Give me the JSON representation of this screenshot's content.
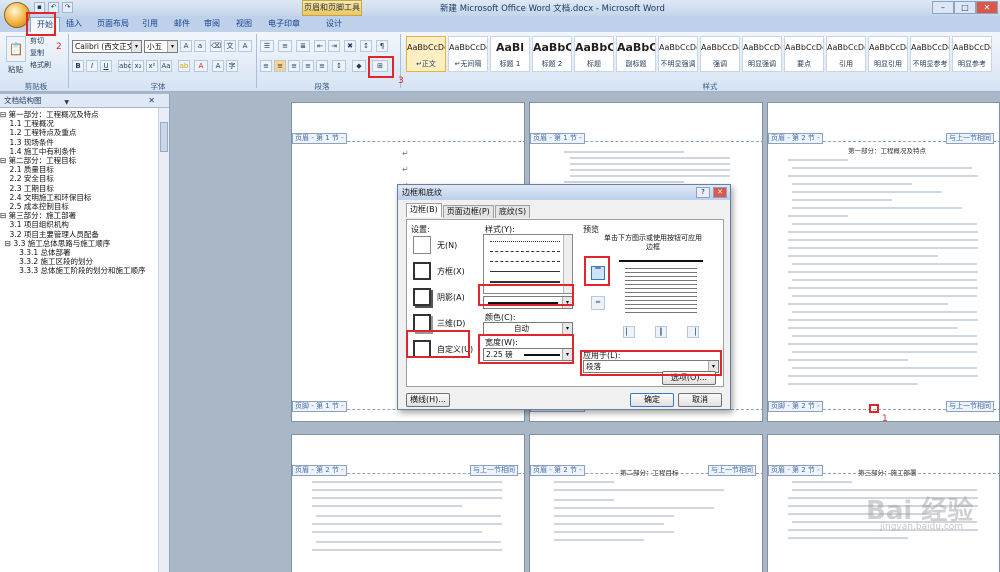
{
  "window": {
    "title": "新建 Microsoft Office Word 文档.docx - Microsoft Word",
    "context_tab": "页眉和页脚工具"
  },
  "tabs": [
    {
      "label": "开始"
    },
    {
      "label": "插入"
    },
    {
      "label": "页面布局"
    },
    {
      "label": "引用"
    },
    {
      "label": "邮件"
    },
    {
      "label": "审阅"
    },
    {
      "label": "视图"
    },
    {
      "label": "电子印章"
    },
    {
      "label": "设计"
    }
  ],
  "ribbon": {
    "clipboard": {
      "paste": "粘贴",
      "cut": "剪切",
      "copy": "复制",
      "format_painter": "格式刷",
      "label": "剪贴板"
    },
    "font": {
      "name": "Calibri (西文正文)",
      "size": "小五",
      "label": "字体"
    },
    "paragraph": {
      "label": "段落"
    },
    "styles": {
      "label": "样式",
      "items": [
        {
          "sample": "AaBbCcDd",
          "label": "↵正文"
        },
        {
          "sample": "AaBbCcDd",
          "label": "↵无间隔"
        },
        {
          "sample": "AaBl",
          "label": "标题 1"
        },
        {
          "sample": "AaBbC",
          "label": "标题 2"
        },
        {
          "sample": "AaBbC",
          "label": "标题"
        },
        {
          "sample": "AaBbC",
          "label": "副标题"
        },
        {
          "sample": "AaBbCcDd",
          "label": "不明显强调"
        },
        {
          "sample": "AaBbCcDd",
          "label": "强调"
        },
        {
          "sample": "AaBbCcDd",
          "label": "明显强调"
        },
        {
          "sample": "AaBbCcDd",
          "label": "要点"
        },
        {
          "sample": "AaBbCcDd",
          "label": "引用"
        },
        {
          "sample": "AaBbCcDd",
          "label": "明显引用"
        },
        {
          "sample": "AaBbCcDd",
          "label": "不明显参考"
        },
        {
          "sample": "AaBbCcDd",
          "label": "明显参考"
        }
      ]
    }
  },
  "annotations": {
    "n1": "1",
    "n2": "2",
    "n3": "3"
  },
  "nav": {
    "title": "文档结构图",
    "items": [
      {
        "text": "⊟ 第一部分：工程概况及特点"
      },
      {
        "text": "    1.1 工程概况"
      },
      {
        "text": "    1.2 工程特点及重点"
      },
      {
        "text": "    1.3 现场条件"
      },
      {
        "text": "    1.4 施工中有利条件"
      },
      {
        "text": "⊟ 第二部分：工程目标"
      },
      {
        "text": "    2.1 质量目标"
      },
      {
        "text": "    2.2 安全目标"
      },
      {
        "text": "    2.3 工期目标"
      },
      {
        "text": "    2.4 文明施工和环保目标"
      },
      {
        "text": "    2.5 成本控制目标"
      },
      {
        "text": "⊟ 第三部分：施工部署"
      },
      {
        "text": "    3.1 项目组织机构"
      },
      {
        "text": "    3.2 项目主要管理人员配备"
      },
      {
        "text": "  ⊟ 3.3 施工总体思路与施工顺序"
      },
      {
        "text": "        3.3.1 总体部署"
      },
      {
        "text": "        3.3.2 施工区段的划分"
      },
      {
        "text": "        3.3.3 总体施工阶段的划分和施工顺序"
      }
    ]
  },
  "pages": {
    "header_s1": "页眉 - 第 1 节 -",
    "header_s2": "页眉 - 第 2 节 -",
    "footer_s1": "页脚 - 第 1 节 -",
    "footer_s2": "页脚 - 第 2 节 -",
    "same_as_prev": "与上一节相同",
    "heading1": "第一部分：工程概况及特点",
    "heading2": "第二部分：工程目标",
    "heading3": "第三部分：施工部署",
    "para_mark": "↵"
  },
  "dialog": {
    "title": "边框和底纹",
    "tabs": [
      {
        "label": "边框(B)"
      },
      {
        "label": "页面边框(P)"
      },
      {
        "label": "底纹(S)"
      }
    ],
    "setting_label": "设置:",
    "settings": [
      {
        "label": "无(N)"
      },
      {
        "label": "方框(X)"
      },
      {
        "label": "阴影(A)"
      },
      {
        "label": "三维(D)"
      },
      {
        "label": "自定义(U)"
      }
    ],
    "style_label": "样式(Y):",
    "color_label": "颜色(C):",
    "color_value": "自动",
    "width_label": "宽度(W):",
    "width_value": "2.25 磅",
    "preview_label": "预览",
    "preview_hint": "单击下方图示或使用按钮可应用边框",
    "apply_label": "应用于(L):",
    "apply_value": "段落",
    "options": "选项(O)...",
    "hline": "横线(H)...",
    "ok": "确定",
    "cancel": "取消"
  },
  "watermark": {
    "text": "Bai 经验",
    "sub": "jingyan.baidu.com"
  }
}
